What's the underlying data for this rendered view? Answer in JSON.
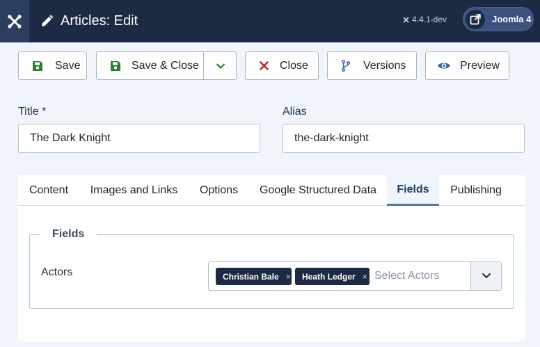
{
  "header": {
    "title": "Articles: Edit",
    "version": "4.4.1-dev",
    "site_link": "Joomla 4",
    "logo_icon": "joomla-logo-icon"
  },
  "toolbar": {
    "save": "Save",
    "save_close": "Save & Close",
    "close": "Close",
    "versions": "Versions",
    "preview": "Preview"
  },
  "form": {
    "title_label": "Title *",
    "title_value": "The Dark Knight",
    "alias_label": "Alias",
    "alias_value": "the-dark-knight"
  },
  "tabs": [
    {
      "label": "Content",
      "active": false
    },
    {
      "label": "Images and Links",
      "active": false
    },
    {
      "label": "Options",
      "active": false
    },
    {
      "label": "Google Structured Data",
      "active": false
    },
    {
      "label": "Fields",
      "active": true
    },
    {
      "label": "Publishing",
      "active": false
    }
  ],
  "fields": {
    "legend": "Fields",
    "actors_label": "Actors",
    "selected": [
      "Christian Bale",
      "Heath Ledger"
    ],
    "remove_glyph": "×",
    "placeholder": "Select Actors"
  },
  "colors": {
    "header_bg": "#1c2a44",
    "save_green": "#2f7d32",
    "close_red": "#c52827",
    "accent_blue": "#3b6aa8"
  }
}
